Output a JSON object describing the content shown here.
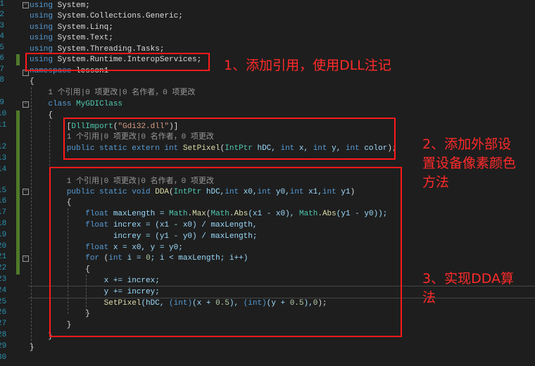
{
  "editor": {
    "lines": [
      {
        "n": "1",
        "t": [
          [
            "using",
            "kw"
          ],
          [
            " System;",
            "pl"
          ]
        ]
      },
      {
        "n": "2",
        "t": [
          [
            "using",
            "kw"
          ],
          [
            " System.Collections.Generic;",
            "pl"
          ]
        ]
      },
      {
        "n": "3",
        "t": [
          [
            "using",
            "kw"
          ],
          [
            " System.Linq;",
            "pl"
          ]
        ]
      },
      {
        "n": "4",
        "t": [
          [
            "using",
            "kw"
          ],
          [
            " System.Text;",
            "pl"
          ]
        ]
      },
      {
        "n": "5",
        "t": [
          [
            "using",
            "kw"
          ],
          [
            " System.Threading.Tasks;",
            "pl"
          ]
        ]
      },
      {
        "n": "6",
        "t": [
          [
            "using",
            "kw"
          ],
          [
            " System.Runtime.InteropServices;",
            "pl"
          ]
        ]
      },
      {
        "n": "7",
        "t": [
          [
            "namespace",
            "kw"
          ],
          [
            " lesson1",
            "pl"
          ]
        ]
      },
      {
        "n": "8",
        "t": [
          [
            "{",
            "pl"
          ]
        ]
      },
      {
        "n": "",
        "t": [
          [
            "    1 个引用|0 项更改|0 名作者，0 项更改",
            "cl"
          ]
        ]
      },
      {
        "n": "9",
        "t": [
          [
            "    class ",
            "kw"
          ],
          [
            "MyGDIClass",
            "ty"
          ]
        ]
      },
      {
        "n": "10",
        "t": [
          [
            "    {",
            "pl"
          ]
        ]
      },
      {
        "n": "11",
        "t": [
          [
            "        [",
            "pl"
          ],
          [
            "DllImport",
            "ty"
          ],
          [
            "(",
            "pl"
          ],
          [
            "\"Gdi32.dll\"",
            "st"
          ],
          [
            ")]",
            "pl"
          ]
        ]
      },
      {
        "n": "",
        "t": [
          [
            "        1 个引用|0 项更改|0 名作者，0 项更改",
            "cl"
          ]
        ]
      },
      {
        "n": "12",
        "t": [
          [
            "        public static extern int ",
            "kw"
          ],
          [
            "SetPixel",
            "fn"
          ],
          [
            "(",
            "pl"
          ],
          [
            "IntPtr",
            "ty"
          ],
          [
            " hDC, ",
            "va"
          ],
          [
            "int",
            "kw"
          ],
          [
            " x, ",
            "va"
          ],
          [
            "int",
            "kw"
          ],
          [
            " y, ",
            "va"
          ],
          [
            "int",
            "kw"
          ],
          [
            " color",
            "va"
          ],
          [
            ");",
            "pl"
          ]
        ]
      },
      {
        "n": "13",
        "t": [
          [
            "",
            "pl"
          ]
        ]
      },
      {
        "n": "14",
        "t": [
          [
            "",
            "pl"
          ]
        ]
      },
      {
        "n": "",
        "t": [
          [
            "        1 个引用|0 项更改|0 名作者，0 项更改",
            "cl"
          ]
        ]
      },
      {
        "n": "15",
        "t": [
          [
            "        public static void ",
            "kw"
          ],
          [
            "DDA",
            "fn"
          ],
          [
            "(",
            "pl"
          ],
          [
            "IntPtr",
            "ty"
          ],
          [
            " hDC,",
            "va"
          ],
          [
            "int",
            "kw"
          ],
          [
            " x0,",
            "va"
          ],
          [
            "int",
            "kw"
          ],
          [
            " y0,",
            "va"
          ],
          [
            "int",
            "kw"
          ],
          [
            " x1,",
            "va"
          ],
          [
            "int",
            "kw"
          ],
          [
            " y1",
            "va"
          ],
          [
            ")",
            "pl"
          ]
        ]
      },
      {
        "n": "16",
        "t": [
          [
            "        {",
            "pl"
          ]
        ]
      },
      {
        "n": "17",
        "t": [
          [
            "            float",
            "kw"
          ],
          [
            " maxLength = ",
            "va"
          ],
          [
            "Math",
            "ty"
          ],
          [
            ".",
            "pl"
          ],
          [
            "Max",
            "fn"
          ],
          [
            "(",
            "pl"
          ],
          [
            "Math",
            "ty"
          ],
          [
            ".",
            "pl"
          ],
          [
            "Abs",
            "fn"
          ],
          [
            "(x1 - x0), ",
            "va"
          ],
          [
            "Math",
            "ty"
          ],
          [
            ".",
            "pl"
          ],
          [
            "Abs",
            "fn"
          ],
          [
            "(y1 - y0));",
            "va"
          ]
        ]
      },
      {
        "n": "18",
        "t": [
          [
            "            float",
            "kw"
          ],
          [
            " increx = (x1 - x0) / maxLength,",
            "va"
          ]
        ]
      },
      {
        "n": "19",
        "t": [
          [
            "                  increy = (y1 - y0) / maxLength;",
            "va"
          ]
        ]
      },
      {
        "n": "20",
        "t": [
          [
            "            float",
            "kw"
          ],
          [
            " x = x0, y = y0;",
            "va"
          ]
        ]
      },
      {
        "n": "21",
        "t": [
          [
            "            for",
            "kw"
          ],
          [
            " (",
            "pl"
          ],
          [
            "int",
            "kw"
          ],
          [
            " i = ",
            "va"
          ],
          [
            "0",
            "nm"
          ],
          [
            "; i < maxLength; i++)",
            "va"
          ]
        ]
      },
      {
        "n": "22",
        "t": [
          [
            "            {",
            "pl"
          ]
        ]
      },
      {
        "n": "23",
        "t": [
          [
            "                x += increx;",
            "va"
          ]
        ]
      },
      {
        "n": "24",
        "t": [
          [
            "                y += increy;",
            "va"
          ]
        ]
      },
      {
        "n": "25",
        "t": [
          [
            "                ",
            "pl"
          ],
          [
            "SetPixel",
            "fn"
          ],
          [
            "(hDC, ",
            "va"
          ],
          [
            "(int)",
            "kw"
          ],
          [
            "(x + ",
            "va"
          ],
          [
            "0.5",
            "nm"
          ],
          [
            "), ",
            "va"
          ],
          [
            "(int)",
            "kw"
          ],
          [
            "(y + ",
            "va"
          ],
          [
            "0.5",
            "nm"
          ],
          [
            "),",
            "va"
          ],
          [
            "0",
            "nm"
          ],
          [
            ");",
            "pl"
          ]
        ]
      },
      {
        "n": "26",
        "t": [
          [
            "            }",
            "pl"
          ]
        ]
      },
      {
        "n": "27",
        "t": [
          [
            "        }",
            "pl"
          ]
        ]
      },
      {
        "n": "28",
        "t": [
          [
            "    }",
            "pl"
          ]
        ]
      },
      {
        "n": "29",
        "t": [
          [
            "}",
            "pl"
          ]
        ]
      },
      {
        "n": "30",
        "t": [
          [
            "",
            "pl"
          ]
        ]
      }
    ]
  },
  "annotations": {
    "note1": "1、添加引用，使用DLL注记",
    "note2_l1": "2、添加外部设",
    "note2_l2": "置设备像素颜色",
    "note2_l3": "方法",
    "note3_l1": "3、实现DDA算",
    "note3_l2": "法",
    "color": "#ff1a1a"
  }
}
